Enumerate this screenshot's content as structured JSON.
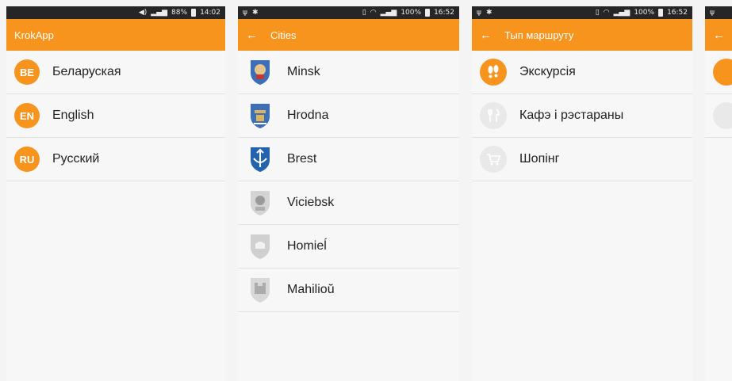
{
  "screens": [
    {
      "status": {
        "time": "14:02",
        "battery": "88%"
      },
      "title": "KrokApp",
      "items": [
        {
          "code": "BE",
          "label": "Беларуская"
        },
        {
          "code": "EN",
          "label": "English"
        },
        {
          "code": "RU",
          "label": "Русский"
        }
      ]
    },
    {
      "status": {
        "time": "16:52",
        "battery": "100%"
      },
      "title": "Cities",
      "items": [
        {
          "label": "Minsk"
        },
        {
          "label": "Hrodna"
        },
        {
          "label": "Brest"
        },
        {
          "label": "Viciebsk"
        },
        {
          "label": "Homieĺ"
        },
        {
          "label": "Mahilioŭ"
        }
      ]
    },
    {
      "status": {
        "time": "16:52",
        "battery": "100%"
      },
      "title": "Тып маршруту",
      "items": [
        {
          "label": "Экскурсія",
          "icon": "footprints-icon",
          "active": true
        },
        {
          "label": "Кафэ і рэстараны",
          "icon": "fork-knife-icon",
          "active": false
        },
        {
          "label": "Шопінг",
          "icon": "shopping-cart-icon",
          "active": false
        }
      ]
    }
  ],
  "colors": {
    "accent": "#f7941d",
    "statusbar": "#262626",
    "background": "#f7f7f7",
    "divider": "#e2e2e2"
  }
}
